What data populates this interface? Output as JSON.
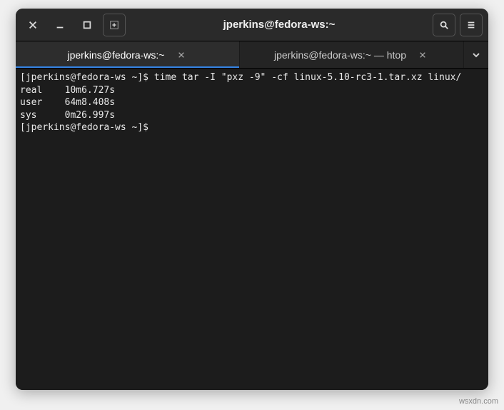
{
  "titlebar": {
    "title": "jperkins@fedora-ws:~"
  },
  "tabs": [
    {
      "label": "jperkins@fedora-ws:~",
      "active": true
    },
    {
      "label": "jperkins@fedora-ws:~ — htop",
      "active": false
    }
  ],
  "terminal": {
    "lines": [
      "[jperkins@fedora-ws ~]$ time tar -I \"pxz -9\" -cf linux-5.10-rc3-1.tar.xz linux/",
      "",
      "real    10m6.727s",
      "user    64m8.408s",
      "sys     0m26.997s",
      "[jperkins@fedora-ws ~]$ "
    ]
  },
  "watermark": "wsxdn.com"
}
